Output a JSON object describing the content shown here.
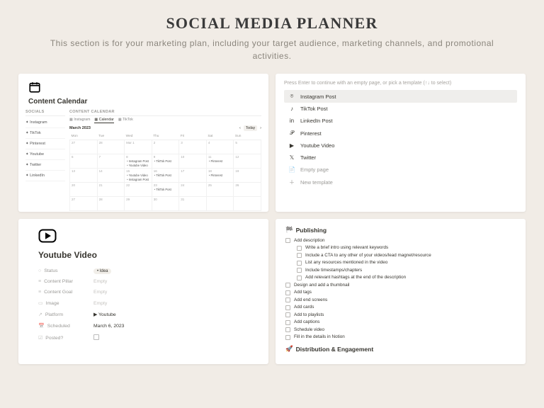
{
  "header": {
    "title": "SOCIAL MEDIA PLANNER",
    "subtitle": "This section is for your marketing plan, including your target audience, marketing channels, and promotional activities."
  },
  "calendar": {
    "title": "Content Calendar",
    "side_head": "SOCIALS",
    "main_head": "CONTENT CALENDAR",
    "socials": [
      "Instagram",
      "TikTok",
      "Pinterest",
      "Youtube",
      "Twitter",
      "LinkedIn"
    ],
    "tabs": [
      "Instagram",
      "Calendar",
      "TikTok"
    ],
    "month": "March 2023",
    "today_label": "Today",
    "days": [
      "Mon",
      "Tue",
      "Wed",
      "Thu",
      "Fri",
      "Sat",
      "Sun"
    ],
    "grid": [
      [
        "27",
        "28",
        "Mar 1",
        "2",
        "3",
        "4",
        "5"
      ],
      [
        "6",
        "7",
        "8",
        "9",
        "10",
        "11",
        "12"
      ],
      [
        "13",
        "14",
        "15",
        "16",
        "17",
        "18",
        "19"
      ],
      [
        "20",
        "21",
        "22",
        "23",
        "24",
        "25",
        "26"
      ],
      [
        "27",
        "28",
        "29",
        "30",
        "31",
        "",
        ""
      ]
    ],
    "events": {
      "r1c2": [
        "Instagram Post",
        "Youtube Video"
      ],
      "r1c3": [
        "TikTok Post"
      ],
      "r1c5": [
        "Pinterest"
      ],
      "r2c2": [
        "Youtube Video",
        "Instagram Post"
      ],
      "r2c3": [
        "TikTok Post"
      ],
      "r2c5": [
        "Pinterest"
      ],
      "r3c3": [
        "TikTok Post"
      ]
    }
  },
  "templates": {
    "hint": "Press Enter to continue with an empty page, or pick a template (↑↓ to select)",
    "items": [
      {
        "icon": "⌾",
        "label": "Instagram Post",
        "selected": true
      },
      {
        "icon": "♪",
        "label": "TikTok Post"
      },
      {
        "icon": "in",
        "label": "LinkedIn Post"
      },
      {
        "icon": "𝒫",
        "label": "Pinterest"
      },
      {
        "icon": "▶",
        "label": "Youtube Video"
      },
      {
        "icon": "𝕏",
        "label": "Twitter"
      },
      {
        "icon": "📄",
        "label": "Empty page",
        "muted": true
      },
      {
        "icon": "＋",
        "label": "New template",
        "muted": true
      }
    ]
  },
  "youtube": {
    "title": "Youtube Video",
    "props": [
      {
        "icon": "○",
        "label": "Status",
        "value": "• Idea",
        "tag": true
      },
      {
        "icon": "≡",
        "label": "Content Pillar",
        "value": "Empty",
        "empty": true
      },
      {
        "icon": "≡",
        "label": "Content Goal",
        "value": "Empty",
        "empty": true
      },
      {
        "icon": "▭",
        "label": "Image",
        "value": "Empty",
        "empty": true
      },
      {
        "icon": "↗",
        "label": "Platform",
        "value": "▶ Youtube"
      },
      {
        "icon": "📅",
        "label": "Scheduled",
        "value": "March 6, 2023"
      },
      {
        "icon": "☑",
        "label": "Posted?",
        "value": "",
        "checkbox": true
      }
    ]
  },
  "publishing": {
    "heading": "Publishing",
    "heading_icon": "🏁",
    "items": [
      {
        "t": "Add description"
      },
      {
        "t": "Write a brief intro using relevant keywords",
        "sub": true
      },
      {
        "t": "Include a CTA to any other of your videos/lead magnet/resource",
        "sub": true
      },
      {
        "t": "List any resources mentioned in the video",
        "sub": true
      },
      {
        "t": "Include timestamps/chapters",
        "sub": true
      },
      {
        "t": "Add relevant hashtags at the end of the description",
        "sub": true
      },
      {
        "t": "Design and add a thumbnail"
      },
      {
        "t": "Add tags"
      },
      {
        "t": "Add end screens"
      },
      {
        "t": "Add cards"
      },
      {
        "t": "Add to playlists"
      },
      {
        "t": "Add captions"
      },
      {
        "t": "Schedule video"
      },
      {
        "t": "Fill in the details in Notion"
      }
    ],
    "heading2": "Distribution & Engagement",
    "heading2_icon": "🚀"
  }
}
